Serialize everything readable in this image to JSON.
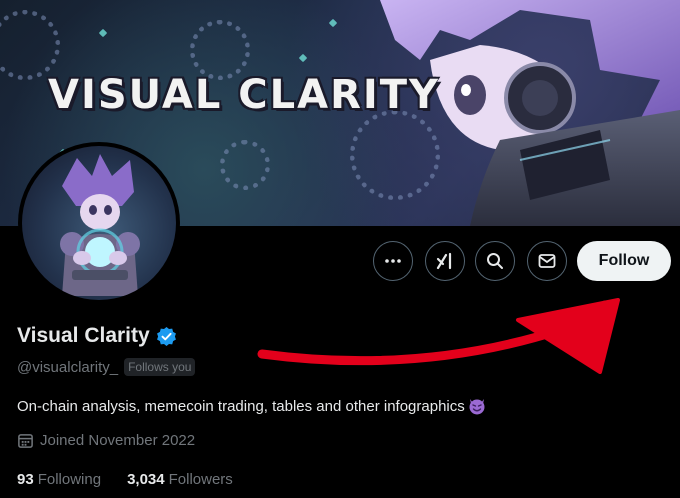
{
  "banner": {
    "title": "VISUAL CLARITY"
  },
  "profile": {
    "display_name": "Visual Clarity",
    "handle": "@visualclarity_",
    "follows_you": "Follows you",
    "bio": "On-chain analysis, memecoin trading, tables and other infographics",
    "joined": "Joined November 2022",
    "following_count": "93",
    "following_label": "Following",
    "followers_count": "3,034",
    "followers_label": "Followers"
  },
  "actions": {
    "more_icon": "more-icon",
    "grok_icon": "grok-icon",
    "search_icon": "search-icon",
    "message_icon": "mail-icon",
    "follow_label": "Follow"
  },
  "colors": {
    "background": "#000000",
    "text_primary": "#e7e9ea",
    "text_secondary": "#71767b",
    "verified": "#1d9bf0",
    "follow_button": "#eff3f4",
    "annotation_arrow": "#e3001b"
  }
}
